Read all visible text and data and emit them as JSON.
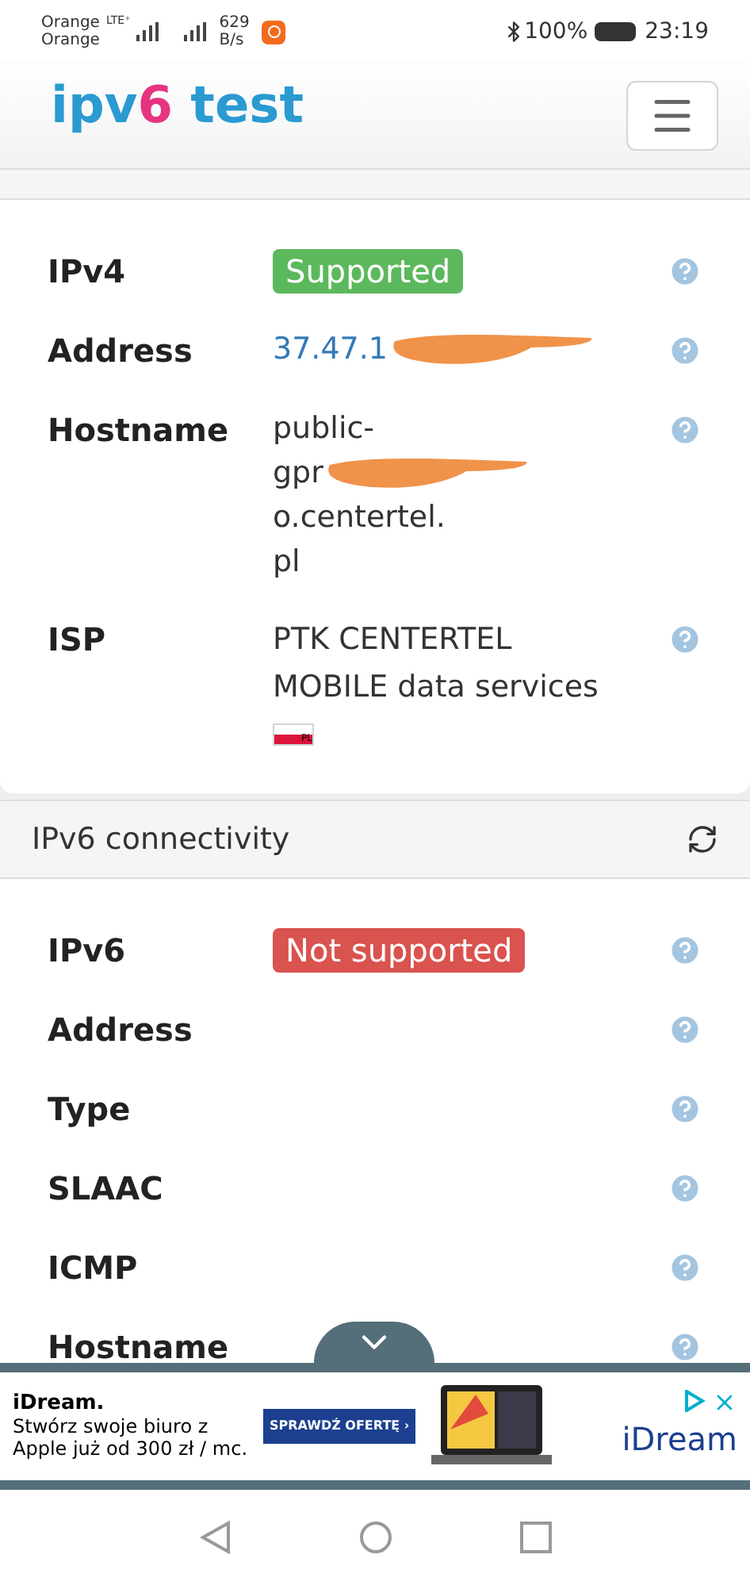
{
  "status_bar": {
    "carrier_1": "Orange",
    "carrier_2": "Orange",
    "network": "LTE⁺",
    "speed_value": "629",
    "speed_unit": "B/s",
    "battery": "100%",
    "time": "23:19"
  },
  "header": {
    "logo_prefix": "ipv",
    "logo_digit": "6",
    "logo_suffix": " test"
  },
  "sections": [
    {
      "rows": [
        {
          "label": "IPv4",
          "kind": "badge",
          "value": "Supported",
          "color": "#5cb85c"
        },
        {
          "label": "Address",
          "kind": "redacted-link",
          "value": "37.47.1"
        },
        {
          "label": "Hostname",
          "kind": "redacted-text",
          "value": "public-",
          "value_after": "gpr",
          "value_end": "o.centertel.",
          "value_last": "pl"
        },
        {
          "label": "ISP",
          "kind": "flag",
          "value": "PTK CENTERTEL MOBILE data services",
          "flag": "PL"
        }
      ]
    },
    {
      "title": "IPv6 connectivity",
      "rows": [
        {
          "label": "IPv6",
          "kind": "badge",
          "value": "Not supported",
          "color": "#d9534f"
        },
        {
          "label": "Address",
          "kind": "empty"
        },
        {
          "label": "Type",
          "kind": "empty"
        },
        {
          "label": "SLAAC",
          "kind": "empty"
        },
        {
          "label": "ICMP",
          "kind": "empty"
        },
        {
          "label": "Hostname",
          "kind": "empty"
        }
      ]
    }
  ],
  "ad": {
    "brand": "iDream.",
    "text": "Stwórz swoje biuro z Apple już od 300 zł / mc.",
    "cta": "SPRAWDŹ OFERTĘ ›",
    "logo": "iDream"
  }
}
